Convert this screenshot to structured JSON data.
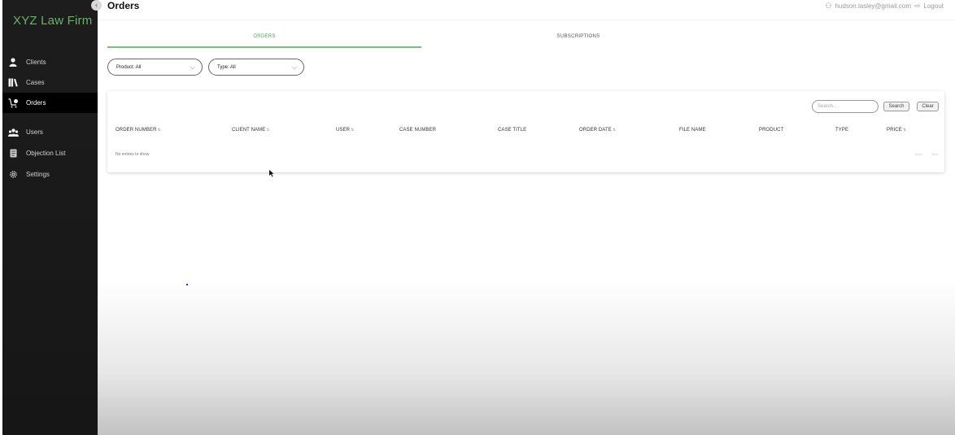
{
  "app": {
    "brand": "XYZ Law Firm",
    "page_title": "Orders"
  },
  "header": {
    "email": "hudson.lasley@gmail.com",
    "logout": "Logout"
  },
  "sidebar": {
    "items": [
      {
        "label": "Clients",
        "icon": "person-icon"
      },
      {
        "label": "Cases",
        "icon": "books-icon"
      },
      {
        "label": "Orders",
        "icon": "cart-icon",
        "active": true
      },
      {
        "label": "Users",
        "icon": "users-icon"
      },
      {
        "label": "Objection List",
        "icon": "document-icon"
      },
      {
        "label": "Settings",
        "icon": "gear-icon"
      }
    ]
  },
  "tabs": [
    {
      "label": "ORDERS",
      "active": true
    },
    {
      "label": "SUBSCRIPTIONS",
      "active": false
    }
  ],
  "filters": {
    "product": "Product: All",
    "type": "Type: All"
  },
  "table": {
    "search_placeholder": "Search...",
    "search_button": "Search",
    "clear_button": "Clear",
    "columns": [
      "ORDER NUMBER",
      "CLIENT NAME",
      "USER",
      "CASE NUMBER",
      "CASE TITLE",
      "ORDER DATE",
      "FILE NAME",
      "PRODUCT",
      "TYPE",
      "PRICE"
    ],
    "sort_glyph": "⇅",
    "empty_message": "No entries to show",
    "pager": {
      "back": "Back",
      "next": "Next"
    }
  },
  "colors": {
    "accent": "#5aa755",
    "sidebar_bg": "#1b1b1b",
    "brand": "#67b464"
  }
}
